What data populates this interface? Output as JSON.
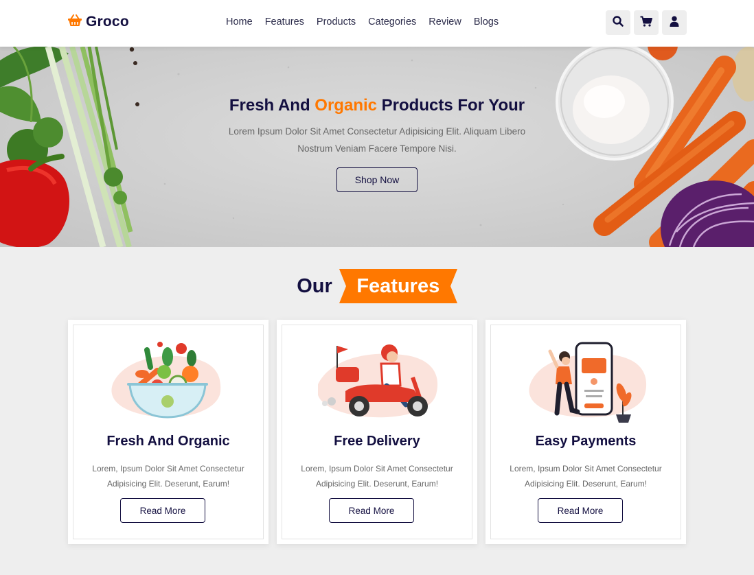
{
  "header": {
    "brand": "Groco",
    "nav": [
      "Home",
      "Features",
      "Products",
      "Categories",
      "Review",
      "Blogs"
    ],
    "icons": [
      "search-icon",
      "cart-icon",
      "user-icon"
    ]
  },
  "hero": {
    "title_before": "Fresh And ",
    "title_accent": "Organic",
    "title_after": " Products For Your",
    "description": "Lorem Ipsum Dolor Sit Amet Consectetur Adipisicing Elit. Aliquam Libero Nostrum Veniam Facere Tempore Nisi.",
    "button": "Shop Now"
  },
  "features": {
    "heading_plain": "Our",
    "heading_accent": "Features",
    "cards": [
      {
        "title": "Fresh And Organic",
        "description": "Lorem, Ipsum Dolor Sit Amet Consectetur Adipisicing Elit. Deserunt, Earum!",
        "button": "Read More",
        "illustration": "salad-bowl"
      },
      {
        "title": "Free Delivery",
        "description": "Lorem, Ipsum Dolor Sit Amet Consectetur Adipisicing Elit. Deserunt, Earum!",
        "button": "Read More",
        "illustration": "delivery-scooter"
      },
      {
        "title": "Easy Payments",
        "description": "Lorem, Ipsum Dolor Sit Amet Consectetur Adipisicing Elit. Deserunt, Earum!",
        "button": "Read More",
        "illustration": "mobile-payment"
      }
    ]
  },
  "colors": {
    "accent": "#ff7800",
    "dark": "#130f40",
    "background": "#eeeeee"
  }
}
